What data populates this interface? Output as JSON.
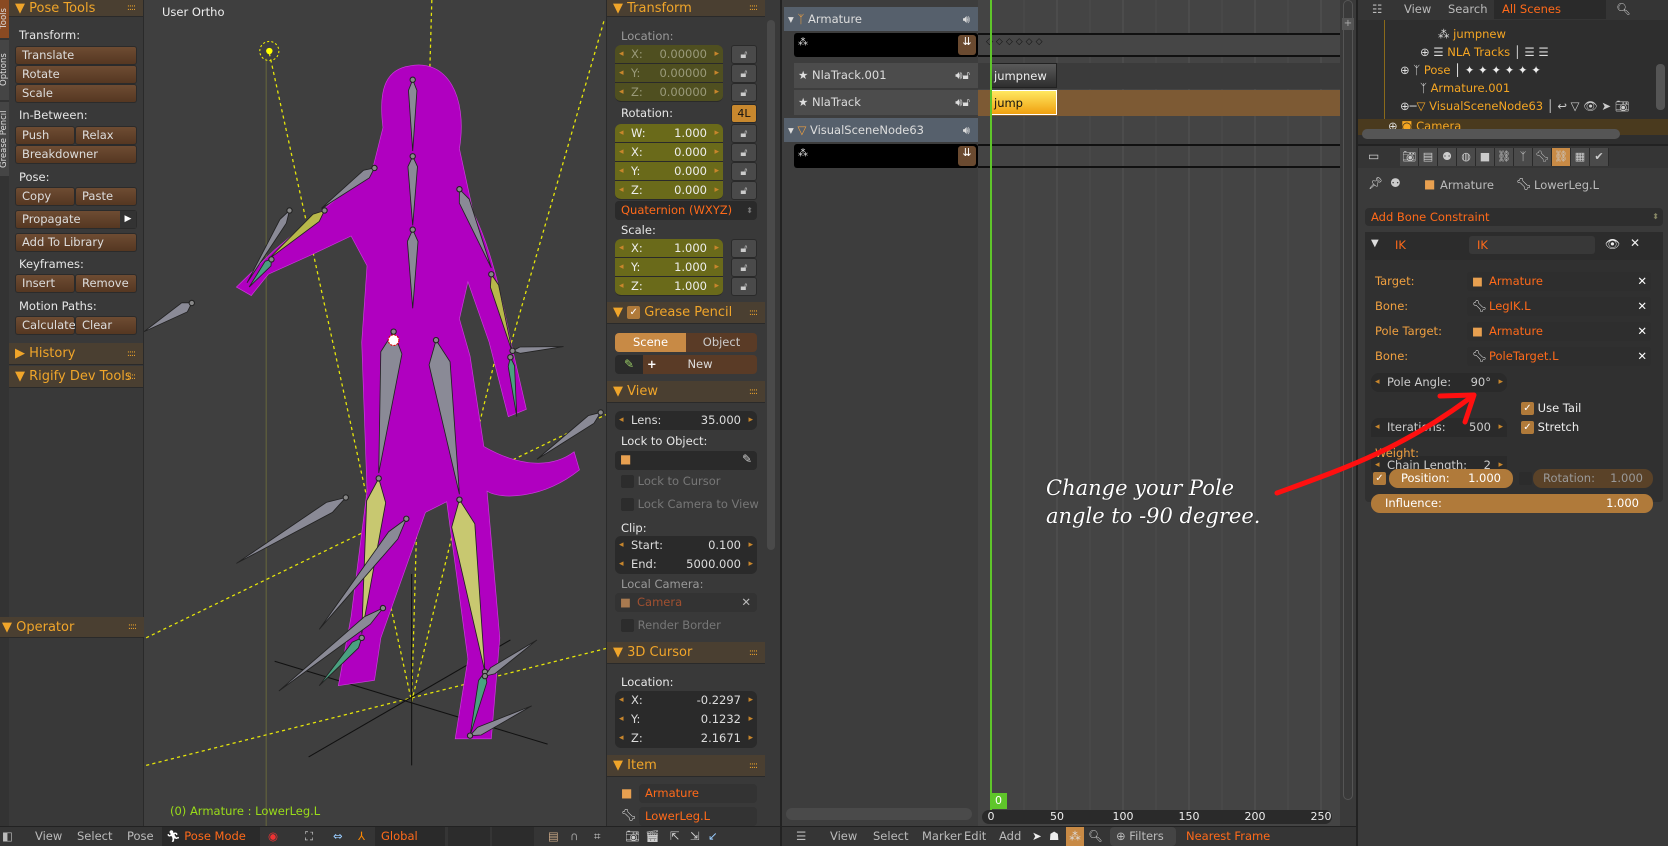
{
  "tool_shelf": {
    "tabs": [
      "Tools",
      "Options",
      "Grease Pencil"
    ],
    "title": "Pose Tools",
    "transform_label": "Transform:",
    "translate": "Translate",
    "rotate": "Rotate",
    "scale": "Scale",
    "inbetween_label": "In-Between:",
    "push": "Push",
    "relax": "Relax",
    "breakdowner": "Breakdowner",
    "pose_label": "Pose:",
    "copy": "Copy",
    "paste": "Paste",
    "propagate": "Propagate",
    "add_to_library": "Add To Library",
    "keyframes_label": "Keyframes:",
    "insert": "Insert",
    "remove": "Remove",
    "motion_paths_label": "Motion Paths:",
    "calculate": "Calculate",
    "clear": "Clear",
    "history": "History",
    "rigify": "Rigify Dev Tools",
    "operator": "Operator"
  },
  "viewport": {
    "view_name": "User Ortho",
    "status": "(0) Armature : LowerLeg.L",
    "annotation": [
      "Change your Pole",
      "angle to -90 degree."
    ]
  },
  "n_panel": {
    "transform": {
      "title": "Transform",
      "location_label": "Location:",
      "location": [
        {
          "axis": "X:",
          "value": "0.00000"
        },
        {
          "axis": "Y:",
          "value": "0.00000"
        },
        {
          "axis": "Z:",
          "value": "0.00000"
        }
      ],
      "rotation_label": "Rotation:",
      "lock_4l": "4L",
      "rotation": [
        {
          "axis": "W:",
          "value": "1.000"
        },
        {
          "axis": "X:",
          "value": "0.000"
        },
        {
          "axis": "Y:",
          "value": "0.000"
        },
        {
          "axis": "Z:",
          "value": "0.000"
        }
      ],
      "rotation_mode": "Quaternion (WXYZ)",
      "scale_label": "Scale:",
      "scale": [
        {
          "axis": "X:",
          "value": "1.000"
        },
        {
          "axis": "Y:",
          "value": "1.000"
        },
        {
          "axis": "Z:",
          "value": "1.000"
        }
      ]
    },
    "grease_pencil": {
      "title": "Grease Pencil",
      "scene": "Scene",
      "object": "Object",
      "new": "New"
    },
    "view": {
      "title": "View",
      "lens_label": "Lens:",
      "lens": "35.000",
      "lock_to_object": "Lock to Object:",
      "lock_to_cursor": "Lock to Cursor",
      "lock_camera": "Lock Camera to View",
      "clip_label": "Clip:",
      "start_label": "Start:",
      "start": "0.100",
      "end_label": "End:",
      "end": "5000.000",
      "local_camera": "Local Camera:",
      "camera": "Camera",
      "render_border": "Render Border"
    },
    "cursor": {
      "title": "3D Cursor",
      "location_label": "Location:",
      "location": [
        {
          "axis": "X:",
          "value": "-0.2297"
        },
        {
          "axis": "Y:",
          "value": "0.1232"
        },
        {
          "axis": "Z:",
          "value": "2.1671"
        }
      ]
    },
    "item": {
      "title": "Item",
      "object": "Armature",
      "bone": "LowerLeg.L"
    }
  },
  "viewport_header": {
    "view": "View",
    "select": "Select",
    "pose": "Pose",
    "mode": "Pose Mode",
    "orientation": "Global"
  },
  "nla": {
    "channels": [
      {
        "name": "Armature",
        "type": "object"
      },
      {
        "name": "NlaTrack.001",
        "type": "track"
      },
      {
        "name": "NlaTrack",
        "type": "track"
      },
      {
        "name": "VisualSceneNode63",
        "type": "object"
      }
    ],
    "strips": [
      {
        "name": "jumpnew",
        "track": "NlaTrack.001"
      },
      {
        "name": "jump",
        "track": "NlaTrack"
      }
    ],
    "current_frame": "0",
    "ruler": [
      "0",
      "50",
      "100",
      "150",
      "200",
      "250"
    ],
    "header": {
      "view": "View",
      "select": "Select",
      "marker": "Marker",
      "edit": "Edit",
      "add": "Add",
      "filters": "Filters",
      "snap": "Nearest Frame"
    }
  },
  "outliner": {
    "header": {
      "view": "View",
      "search": "Search",
      "display": "All Scenes"
    },
    "rows": [
      "jumpnew",
      "NLA Tracks",
      "Pose",
      "Armature.001",
      "VisualSceneNode63",
      "Camera"
    ]
  },
  "properties": {
    "breadcrumb": [
      "Armature",
      "LowerLeg.L"
    ],
    "add_constraint": "Add Bone Constraint",
    "constraint": {
      "type": "IK",
      "name": "IK",
      "target_label": "Target:",
      "target": "Armature",
      "bone_label": "Bone:",
      "bone": "LegIK.L",
      "pole_target_label": "Pole Target:",
      "pole_target": "Armature",
      "pole_bone_label": "Bone:",
      "pole_bone": "PoleTarget.L",
      "pole_angle_label": "Pole Angle:",
      "pole_angle": "90°",
      "iterations_label": "Iterations:",
      "iterations": "500",
      "chain_label": "Chain Length:",
      "chain": "2",
      "use_tail": "Use Tail",
      "stretch": "Stretch",
      "weight_label": "Weight:",
      "position_label": "Position:",
      "position": "1.000",
      "rotation_label": "Rotation:",
      "rotation": "1.000",
      "influence_label": "Influence:",
      "influence": "1.000"
    }
  },
  "colors": {
    "accent": "#f0a52a",
    "field_text": "#ff6a1a",
    "annotation": "#ff1010",
    "frame": "#5fc62a"
  }
}
